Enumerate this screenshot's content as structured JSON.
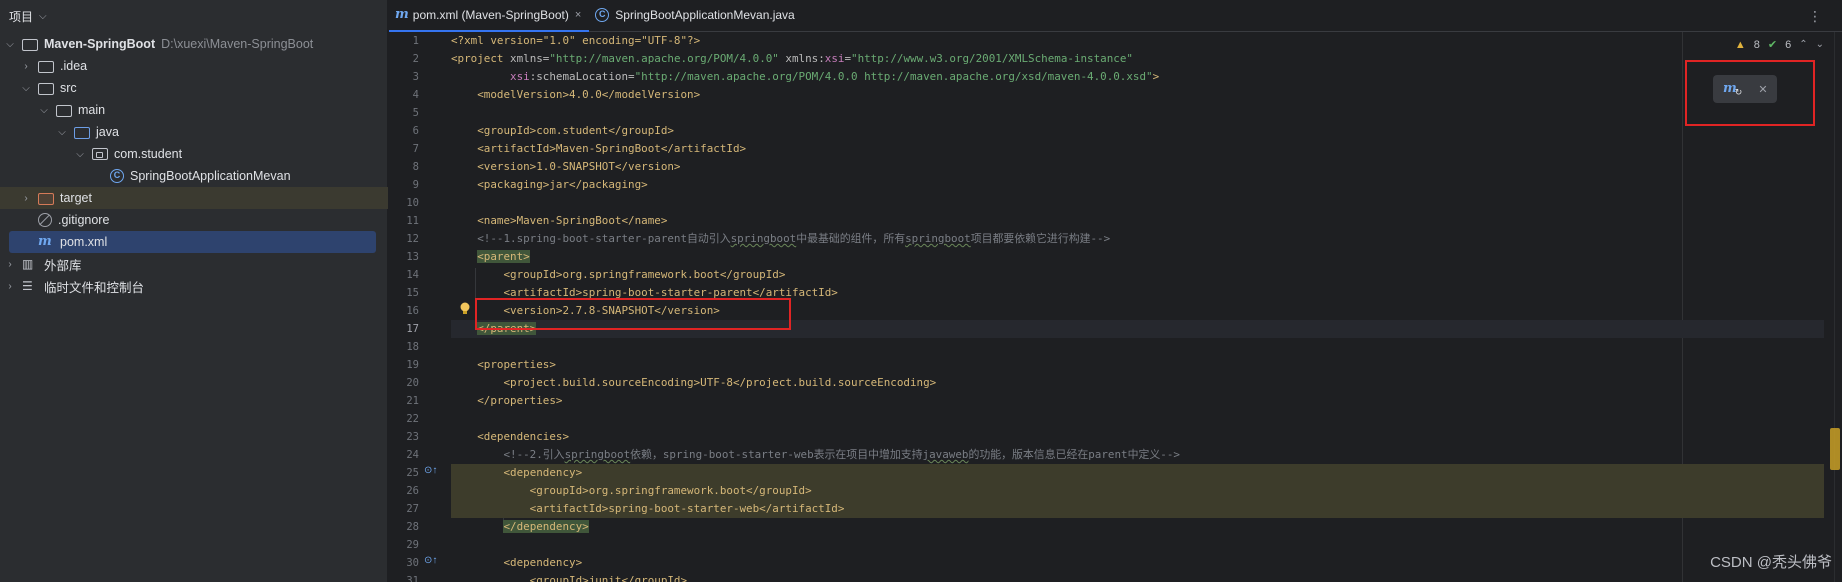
{
  "project_panel": {
    "title": "项目",
    "items": [
      {
        "label": "Maven-SpringBoot",
        "path": "D:\\xuexi\\Maven-SpringBoot"
      },
      {
        "label": ".idea"
      },
      {
        "label": "src"
      },
      {
        "label": "main"
      },
      {
        "label": "java"
      },
      {
        "label": "com.student"
      },
      {
        "label": "SpringBootApplicationMevan"
      },
      {
        "label": "target"
      },
      {
        "label": ".gitignore"
      },
      {
        "label": "pom.xml"
      },
      {
        "label": "外部库"
      },
      {
        "label": "临时文件和控制台"
      }
    ]
  },
  "tabs": [
    {
      "label": "pom.xml (Maven-SpringBoot)",
      "close": "×"
    },
    {
      "label": "SpringBootApplicationMevan.java"
    }
  ],
  "inspections": {
    "warnings": "8",
    "ok": "6"
  },
  "editor": {
    "line_numbers": [
      "1",
      "2",
      "3",
      "4",
      "5",
      "6",
      "7",
      "8",
      "9",
      "10",
      "11",
      "12",
      "13",
      "14",
      "15",
      "16",
      "17",
      "18",
      "19",
      "20",
      "21",
      "22",
      "23",
      "24",
      "25",
      "26",
      "27",
      "28",
      "29",
      "30",
      "31"
    ],
    "current_line": "17"
  },
  "code": {
    "l1": "<?xml version=\"1.0\" encoding=\"UTF-8\"?>",
    "l2a": "<project",
    "l2b": " xmlns=",
    "l2c": "\"http://maven.apache.org/POM/4.0.0\"",
    "l2d": " xmlns:",
    "l2e": "xsi",
    "l2f": "=",
    "l2g": "\"http://www.w3.org/2001/XMLSchema-instance\"",
    "l3a": "         xsi",
    "l3b": ":schemaLocation=",
    "l3c": "\"http://maven.apache.org/POM/4.0.0 http://maven.apache.org/xsd/maven-4.0.0.xsd\"",
    "l3d": ">",
    "l4": "    <modelVersion>4.0.0</modelVersion>",
    "l6": "    <groupId>com.student</groupId>",
    "l7": "    <artifactId>Maven-SpringBoot</artifactId>",
    "l8": "    <version>1.0-SNAPSHOT</version>",
    "l9": "    <packaging>jar</packaging>",
    "l11": "    <name>Maven-SpringBoot</name>",
    "l12a": "    <!--1.spring-boot-starter-parent自动引入",
    "l12b": "springboot",
    "l12c": "中最基础的组件，所有",
    "l12d": "springboot",
    "l12e": "项目都要依赖它进行构建-->",
    "l13": "<parent>",
    "l14": "        <groupId>org.springframework.boot</groupId>",
    "l15": "        <artifactId>spring-boot-starter-parent</artifactId>",
    "l16": "        <version>2.7.8-SNAPSHOT</version>",
    "l17": "</parent>",
    "l19": "    <properties>",
    "l20": "        <project.build.sourceEncoding>UTF-8</project.build.sourceEncoding>",
    "l21": "    </properties>",
    "l23": "    <dependencies>",
    "l24a": "        <!--2.引入",
    "l24b": "springboot",
    "l24c": "依赖，spring-boot-starter-web表示在项目中增加支持",
    "l24d": "javaweb",
    "l24e": "的功能，版本信息已经在parent中定义-->",
    "l25": "<dependency>",
    "l26": "            <groupId>org.springframework.boot</groupId>",
    "l27": "            <artifactId>spring-boot-starter-web</artifactId>",
    "l28": "</dependency>",
    "l30": "        <dependency>",
    "l31": "            <groupId>junit</groupId>"
  },
  "watermark": "CSDN @秃头佛爷"
}
